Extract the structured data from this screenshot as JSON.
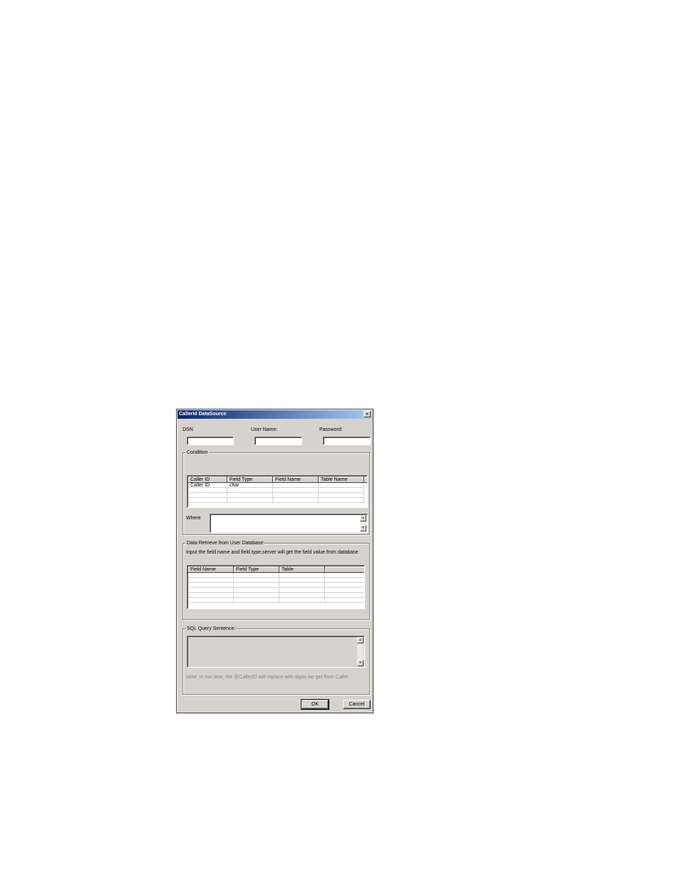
{
  "window": {
    "title": "CallerId DataSource",
    "close_glyph": "×"
  },
  "connection": {
    "dsn_label": "DSN",
    "dsn_value": "",
    "user_label": "User Name:",
    "user_value": "",
    "password_label": "Password:",
    "password_value": ""
  },
  "condition": {
    "group_title": "Condition",
    "columns": [
      "Caller ID",
      "Field Type",
      "Field Name",
      "Table Name"
    ],
    "rows": [
      [
        "Caller ID",
        "char",
        "",
        ""
      ],
      [
        "",
        "",
        "",
        ""
      ],
      [
        "",
        "",
        "",
        ""
      ],
      [
        "",
        "",
        "",
        ""
      ]
    ],
    "where_label": "Where",
    "where_value": ""
  },
  "retrieve": {
    "group_title": "Data Retrieve from User Database",
    "description": "Input the field name and field type,server will get the field value from database",
    "columns": [
      "Field Name",
      "Field Type",
      "Table",
      ""
    ],
    "rows": [
      [
        "",
        "",
        "",
        ""
      ],
      [
        "",
        "",
        "",
        ""
      ],
      [
        "",
        "",
        "",
        ""
      ],
      [
        "",
        "",
        "",
        ""
      ],
      [
        "",
        "",
        "",
        ""
      ],
      [
        "",
        "",
        "",
        ""
      ]
    ]
  },
  "sql": {
    "group_title": "SQL Query Sentence:",
    "value": "",
    "note": "Note: In run time, the @CallerID will replace with digits we get from Caller."
  },
  "buttons": {
    "ok_label": "OK",
    "cancel_label": "Cancel"
  },
  "icons": {
    "scroll_up": "▲",
    "scroll_down": "▼"
  },
  "colors": {
    "dialog_bg": "#d6d3ce",
    "title_gradient_start": "#0a246a",
    "title_gradient_end": "#a6caf0"
  }
}
